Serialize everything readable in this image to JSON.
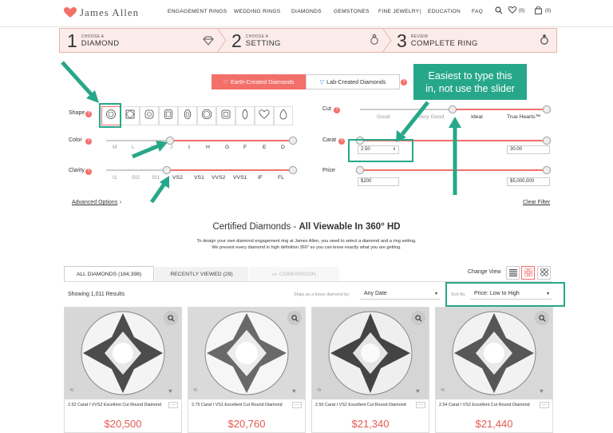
{
  "header": {
    "brand": "James Allen",
    "nav": [
      "ENGAGEMENT RINGS",
      "WEDDING RINGS",
      "DIAMONDS",
      "GEMSTONES",
      "FINE JEWELRY",
      "|",
      "EDUCATION",
      "FAQ"
    ],
    "wishlist_count": "(0)",
    "cart_count": "(0)"
  },
  "steps": [
    {
      "num": "1",
      "small": "CHOOSE A",
      "big": "DIAMOND"
    },
    {
      "num": "2",
      "small": "CHOOSE A",
      "big": "SETTING"
    },
    {
      "num": "3",
      "small": "REVIEW",
      "big": "COMPLETE RING"
    }
  ],
  "origin_toggle": {
    "earth": "Earth-Created Diamonds",
    "lab": "Lab-Created Diamonds"
  },
  "filters": {
    "shape_label": "Shape",
    "color_label": "Color",
    "clarity_label": "Clarity",
    "cut_label": "Cut",
    "carat_label": "Carat",
    "price_label": "Price",
    "color_ticks": [
      "M",
      "L",
      "K",
      "J",
      "I",
      "H",
      "G",
      "F",
      "E",
      "D"
    ],
    "clarity_ticks": [
      "I1",
      "SI2",
      "SI1",
      "VS2",
      "VS1",
      "VVS2",
      "VVS1",
      "IF",
      "FL"
    ],
    "cut_ticks": [
      "Good",
      "Very Good",
      "Ideal",
      "True Hearts™"
    ],
    "carat_min": "2.50",
    "carat_max": "30.00",
    "price_min": "$200",
    "price_max": "$5,000,000",
    "advanced": "Advanced Options",
    "clear": "Clear Filter"
  },
  "heading": {
    "prefix": "Certified Diamonds - ",
    "bold": "All Viewable In 360° HD"
  },
  "subtext": [
    "To design your own diamond engagement ring at James Allen, you need to select a diamond and a ring setting.",
    "We present every diamond in high definition 360° so you can know exactly what you are getting."
  ],
  "tabs": {
    "all": "ALL DIAMONDS (184,398)",
    "recent": "RECENTLY VIEWED (29)",
    "compare": "COMPARISON",
    "change_view": "Change View"
  },
  "results_label": "Showing 1,011 Results",
  "shipping": {
    "label": "Ships as a loose diamond by:",
    "value": "Any Date"
  },
  "sort": {
    "label": "Sort By",
    "value": "Price: Low to High"
  },
  "cards": [
    {
      "title": "2.52 Carat I VVS2 Excellent Cut Round Diamond",
      "price": "$20,500"
    },
    {
      "title": "2.75 Carat I VS1 Excellent Cut Round Diamond",
      "price": "$20,760"
    },
    {
      "title": "2.50 Carat I VS2 Excellent Cut Round Diamond",
      "price": "$21,340"
    },
    {
      "title": "2.54 Carat I VS2 Excellent Cut Round Diamond",
      "price": "$21,440"
    }
  ],
  "callout": {
    "line1": "Easiest to type this",
    "line2": "in, not use the slider"
  },
  "colors": {
    "accent": "#f36f6a",
    "annotation": "#27a78a",
    "price": "#e35a52"
  }
}
